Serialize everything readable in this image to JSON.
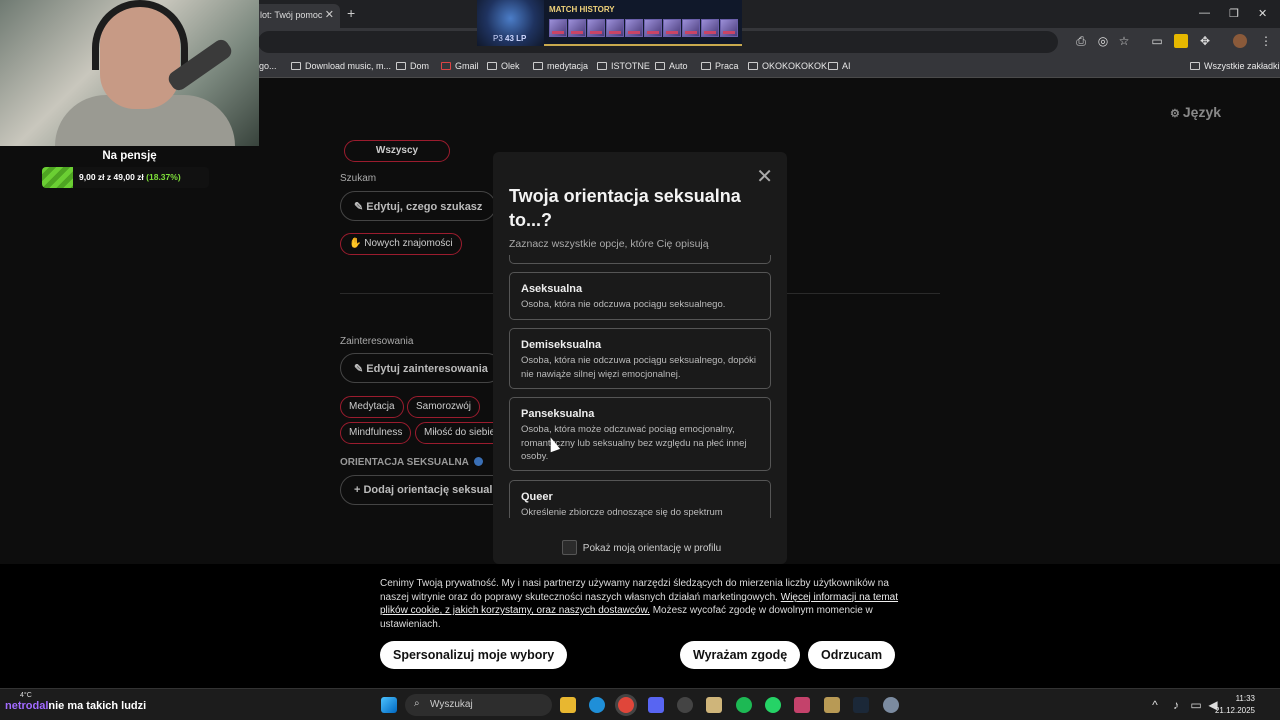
{
  "browser": {
    "tab_title": "lot: Twój pomoc",
    "bookmarks": [
      {
        "label": "Download music, m..."
      },
      {
        "label": "Dom"
      },
      {
        "label": "Gmail"
      },
      {
        "label": "Olek"
      },
      {
        "label": "medytacja"
      },
      {
        "label": "ISTOTNE"
      },
      {
        "label": "Auto"
      },
      {
        "label": "Praca"
      },
      {
        "label": "OKOKOKOKOK"
      },
      {
        "label": "AI"
      }
    ],
    "bookmark_partial": "go...",
    "all_bookmarks": "Wszystkie zakładki"
  },
  "page": {
    "language_button": "Język",
    "everyone_pill": "Wszyscy",
    "seeking_label": "Szukam",
    "edit_seeking": "Edytuj, czego szukasz",
    "new_friends_pill": "Nowych znajomości",
    "interests_label": "Zainteresowania",
    "edit_interests": "Edytuj zainteresowania",
    "interests": [
      "Medytacja",
      "Samorozwój",
      "Mindfulness",
      "Miłość do siebie"
    ],
    "orientation_label": "ORIENTACJA SEKSUALNA",
    "add_orientation": "Dodaj orientację seksualną"
  },
  "modal": {
    "title": "Twoja orientacja seksualna to...?",
    "subtitle": "Zaznacz wszystkie opcje, które Cię opisują",
    "options": [
      {
        "title": "Aseksualna",
        "desc": "Osoba, która nie odczuwa pociągu seksualnego."
      },
      {
        "title": "Demiseksualna",
        "desc": "Osoba, która nie odczuwa pociągu seksualnego, dopóki nie nawiąże silnej więzi emocjonalnej."
      },
      {
        "title": "Panseksualna",
        "desc": "Osoba, która może odczuwać pociąg emocjonalny, romantyczny lub seksualny bez względu na płeć innej osoby."
      },
      {
        "title": "Queer",
        "desc": "Określenie zbiorcze odnoszące się do spektrum"
      }
    ],
    "show_in_profile": "Pokaż moją orientację w profilu"
  },
  "cookie": {
    "text_1": "Cenimy Twoją prywatność. My i nasi partnerzy używamy narzędzi śledzących do mierzenia liczby użytkowników na naszej witrynie oraz do poprawy skuteczności naszych własnych działań marketingowych. ",
    "link": "Więcej informacji na temat plików cookie, z jakich korzystamy, oraz naszych dostawców.",
    "text_2": " Możesz wycofać zgodę w dowolnym momencie w ustawieniach.",
    "personalize": "Spersonalizuj moje wybory",
    "accept": "Wyrażam zgodę",
    "reject": "Odrzucam"
  },
  "stream": {
    "goal_title": "Na pensję",
    "goal_amount": "9,00 zł",
    "goal_of": "z",
    "goal_target": "49,00 zł",
    "goal_pct": "(18.37%)",
    "goal_fraction": 0.1837,
    "match_title": "MATCH HISTORY",
    "rank": "P3",
    "lp": "43 LP",
    "match_count": 10,
    "chat_nick": "netrodal",
    "chat_msg": "nie ma takich ludzi",
    "weather": "4°C"
  },
  "taskbar": {
    "search": "Wyszukaj",
    "time": "11:33",
    "date": "21.12.2025"
  },
  "colors": {
    "accent_red": "#9b1c2e",
    "goal_green": "#6bcf33",
    "match_gold": "#c8a94e"
  }
}
